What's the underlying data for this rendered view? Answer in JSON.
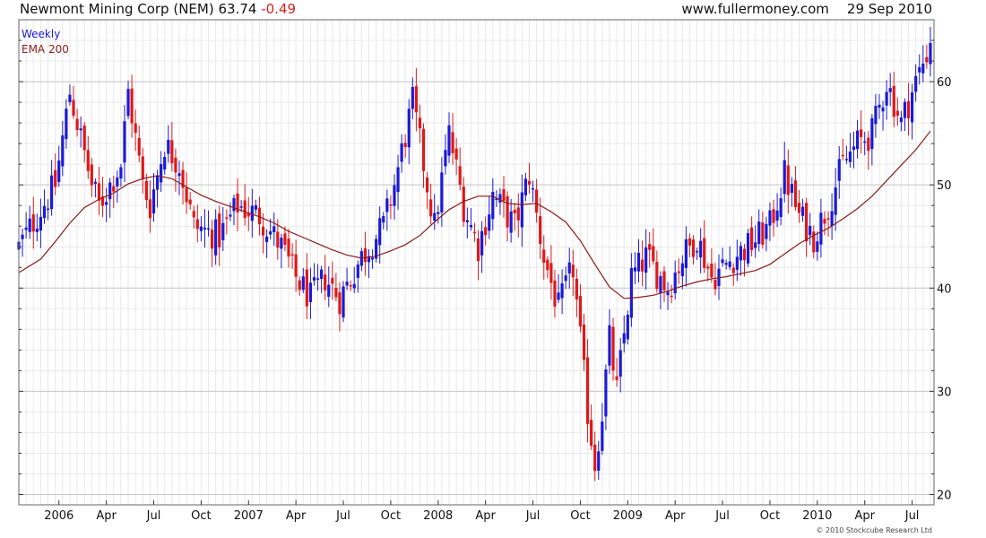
{
  "header": {
    "symbol": "Newmont Mining Corp (NEM)",
    "last": "63.74",
    "change": "-0.49",
    "site": "www.fullermoney.com",
    "date": "29 Sep 2010"
  },
  "legend": {
    "weekly": "Weekly",
    "ema": "EMA 200"
  },
  "credit": "© 2010 Stockcube Research Ltd",
  "colors": {
    "up": "#1a1ad8",
    "down": "#e01818",
    "ema": "#8b1a1a",
    "grid": "#d4d4d4"
  },
  "chart_data": {
    "type": "line",
    "ylim": [
      19,
      66
    ],
    "yticks": [
      20,
      30,
      40,
      50,
      60
    ],
    "xlim": [
      0,
      251
    ],
    "xticks": [
      {
        "label": "2006",
        "week": 11
      },
      {
        "label": "Apr",
        "week": 24
      },
      {
        "label": "Jul",
        "week": 37
      },
      {
        "label": "Oct",
        "week": 50
      },
      {
        "label": "2007",
        "week": 63
      },
      {
        "label": "Apr",
        "week": 76
      },
      {
        "label": "Jul",
        "week": 89
      },
      {
        "label": "Oct",
        "week": 102
      },
      {
        "label": "2008",
        "week": 115
      },
      {
        "label": "Apr",
        "week": 128
      },
      {
        "label": "Jul",
        "week": 141
      },
      {
        "label": "Oct",
        "week": 154
      },
      {
        "label": "2009",
        "week": 167
      },
      {
        "label": "Apr",
        "week": 180
      },
      {
        "label": "Jul",
        "week": 193
      },
      {
        "label": "Oct",
        "week": 206
      },
      {
        "label": "2010",
        "week": 219
      },
      {
        "label": "Apr",
        "week": 232
      },
      {
        "label": "Jul",
        "week": 245
      },
      {
        "label": "Oct",
        "week": 258
      }
    ],
    "series": [
      {
        "name": "Weekly",
        "kind": "close",
        "x": [
          0,
          10,
          14,
          20,
          22,
          28,
          30,
          34,
          36,
          40,
          44,
          48,
          55,
          60,
          66,
          72,
          76,
          80,
          84,
          88,
          94,
          100,
          103,
          108,
          114,
          118,
          122,
          126,
          130,
          136,
          140,
          144,
          148,
          152,
          156,
          158,
          160,
          162,
          164,
          168,
          172,
          178,
          182,
          186,
          190,
          196,
          200,
          206,
          210,
          214,
          218,
          222,
          226,
          230,
          234,
          238,
          242,
          246,
          250
        ],
        "values": [
          44,
          50,
          59,
          50,
          48,
          52,
          59,
          50,
          48,
          54,
          52,
          46,
          45,
          48,
          47,
          44,
          41,
          39,
          41,
          39,
          43,
          46,
          50,
          58,
          46,
          55,
          48,
          44,
          49,
          46,
          51,
          43,
          38,
          42,
          28,
          23,
          28,
          35,
          30,
          41,
          43,
          40,
          43,
          45,
          41,
          43,
          44,
          46,
          51,
          47,
          45,
          48,
          52,
          54,
          55,
          60,
          56,
          60,
          63.74
        ]
      },
      {
        "name": "EMA 200",
        "kind": "ema",
        "x": [
          0,
          6,
          10,
          14,
          18,
          22,
          26,
          30,
          34,
          38,
          42,
          46,
          50,
          54,
          58,
          62,
          66,
          70,
          74,
          78,
          82,
          86,
          90,
          94,
          98,
          102,
          106,
          110,
          114,
          118,
          122,
          126,
          130,
          134,
          138,
          142,
          146,
          150,
          154,
          158,
          162,
          166,
          170,
          174,
          178,
          182,
          186,
          190,
          194,
          198,
          202,
          206,
          210,
          214,
          218,
          222,
          226,
          230,
          234,
          238,
          242,
          246,
          250
        ],
        "values": [
          41.5,
          42.8,
          44.5,
          46.3,
          47.8,
          48.6,
          49.2,
          50.1,
          50.6,
          50.9,
          50.6,
          49.8,
          49.0,
          48.4,
          47.9,
          47.4,
          46.9,
          46.3,
          45.5,
          44.9,
          44.3,
          43.7,
          43.2,
          42.9,
          43.1,
          43.6,
          44.2,
          45.1,
          46.4,
          47.6,
          48.4,
          48.9,
          48.9,
          48.2,
          48.1,
          48.2,
          47.4,
          46.4,
          44.6,
          42.3,
          40.1,
          39.0,
          39.1,
          39.3,
          39.7,
          40.2,
          40.6,
          40.9,
          41.1,
          41.4,
          41.7,
          42.3,
          43.3,
          44.3,
          45.1,
          45.8,
          46.7,
          47.7,
          48.9,
          50.4,
          51.9,
          53.4,
          55.2
        ]
      }
    ]
  }
}
